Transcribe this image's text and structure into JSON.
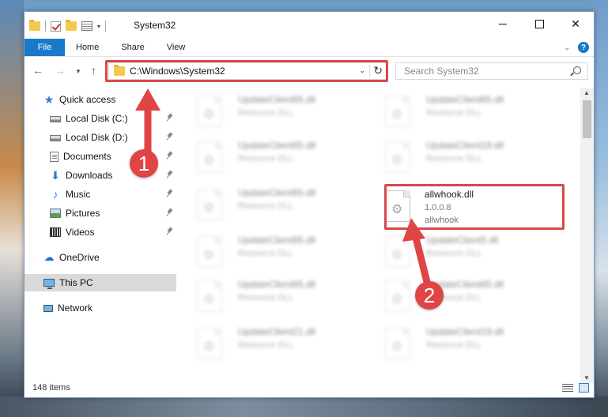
{
  "window": {
    "title": "System32"
  },
  "ribbon": {
    "tabs": [
      "File",
      "Home",
      "Share",
      "View"
    ],
    "help": "?"
  },
  "navigation": {
    "address": "C:\\Windows\\System32",
    "search_placeholder": "Search System32"
  },
  "sidebar": {
    "items": [
      {
        "label": "Quick access",
        "icon": "star-icon"
      },
      {
        "label": "Local Disk (C:)",
        "icon": "drive-icon",
        "pinned": true
      },
      {
        "label": "Local Disk (D:)",
        "icon": "drive-icon",
        "pinned": true
      },
      {
        "label": "Documents",
        "icon": "documents-icon",
        "pinned": true
      },
      {
        "label": "Downloads",
        "icon": "download-icon",
        "pinned": true
      },
      {
        "label": "Music",
        "icon": "music-icon",
        "pinned": true
      },
      {
        "label": "Pictures",
        "icon": "pictures-icon",
        "pinned": true
      },
      {
        "label": "Videos",
        "icon": "videos-icon",
        "pinned": true
      },
      {
        "label": "OneDrive",
        "icon": "cloud-icon"
      },
      {
        "label": "This PC",
        "icon": "computer-icon",
        "selected": true
      },
      {
        "label": "Network",
        "icon": "network-icon"
      }
    ]
  },
  "files": {
    "left": [
      {
        "name": "UpdateClient65.dll",
        "type": "Resource DLL"
      },
      {
        "name": "UpdateClient65.dll",
        "type": "Resource DLL"
      },
      {
        "name": "UpdateClient65.dll",
        "type": "Resource DLL"
      },
      {
        "name": "UpdateClient65.dll",
        "type": "Resource DLL"
      },
      {
        "name": "UpdateClient65.dll",
        "type": "Resource DLL"
      },
      {
        "name": "UpdateClient21.dll",
        "type": "Resource DLL"
      }
    ],
    "right": [
      {
        "name": "UpdateClient65.dll",
        "type": "Resource DLL"
      },
      {
        "name": "UpdateClient19.dll",
        "type": "Resource DLL"
      },
      {
        "name": "allwhook.dll",
        "version": "1.0.0.8",
        "type": "allwhook",
        "highlighted": true
      },
      {
        "name": "UpdateClient5.dll",
        "type": "Resource DLL"
      },
      {
        "name": "UpdateClient65.dll",
        "type": "Resource DLL"
      },
      {
        "name": "UpdateClient19.dll",
        "type": "Resource DLL"
      }
    ]
  },
  "status": {
    "item_count": "148 items"
  },
  "annotations": {
    "step1": "1",
    "step2": "2",
    "color": "#e04545"
  }
}
